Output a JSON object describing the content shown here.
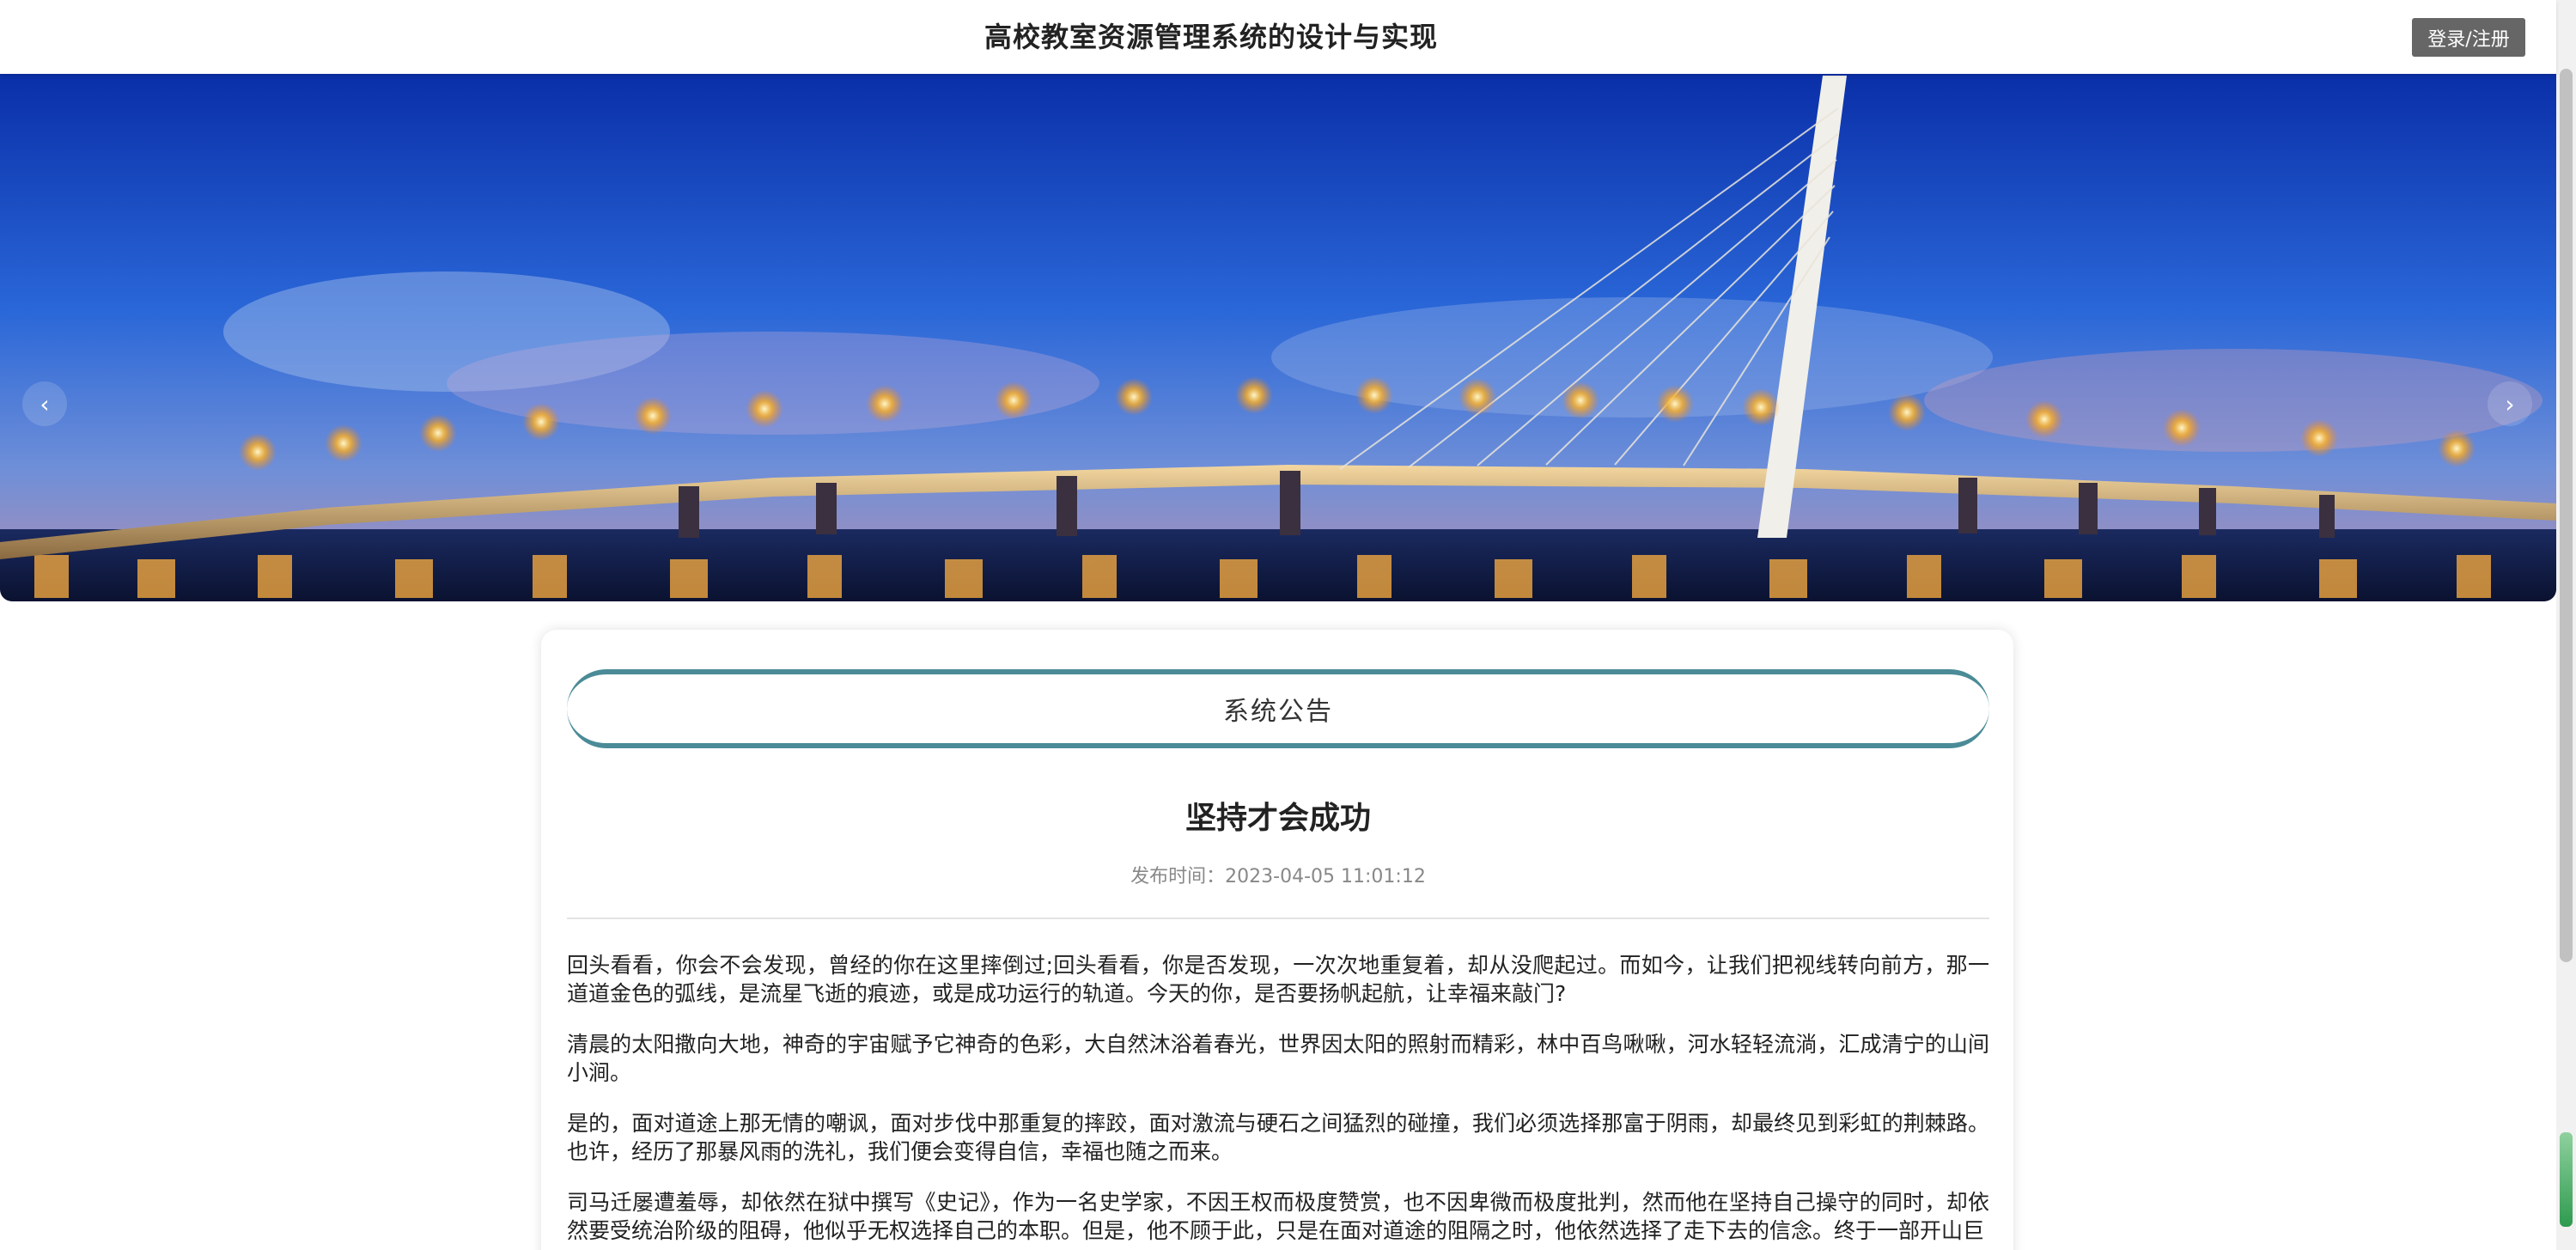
{
  "header": {
    "title": "高校教室资源管理系统的设计与实现",
    "login_label": "登录/注册"
  },
  "banner": {
    "prev_icon": "‹",
    "next_icon": "›",
    "slides_count": 3,
    "active_slide": 1
  },
  "notice": {
    "section_title": "系统公告",
    "title": "坚持才会成功",
    "meta": "发布时间：2023-04-05 11:01:12",
    "paragraphs": [
      "回头看看，你会不会发现，曾经的你在这里摔倒过;回头看看，你是否发现，一次次地重复着，却从没爬起过。而如今，让我们把视线转向前方，那一道道金色的弧线，是流星飞逝的痕迹，或是成功运行的轨道。今天的你，是否要扬帆起航，让幸福来敲门?",
      "清晨的太阳撒向大地，神奇的宇宙赋予它神奇的色彩，大自然沐浴着春光，世界因太阳的照射而精彩，林中百鸟啾啾，河水轻轻流淌，汇成清宁的山间小涧。",
      "是的，面对道途上那无情的嘲讽，面对步伐中那重复的摔跤，面对激流与硬石之间猛烈的碰撞，我们必须选择那富于阴雨，却最终见到彩虹的荆棘路。也许，经历了那暴风雨的洗礼，我们便会变得自信，幸福也随之而来。",
      "司马迁屡遭羞辱，却依然在狱中撰写《史记》，作为一名史学家，不因王权而极度赞赏，也不因卑微而极度批判，然而他在坚持自己操守的同时，却依然要受统治阶级的阻碍，他似乎无权选择自己的本职。但是，他不顾于此，只是在面对道途的阻隔之时，他依然选择了走下去的信念。终于一部开山巨"
    ]
  },
  "colors": {
    "accent": "#4a8b97",
    "login_bg": "#666666"
  }
}
